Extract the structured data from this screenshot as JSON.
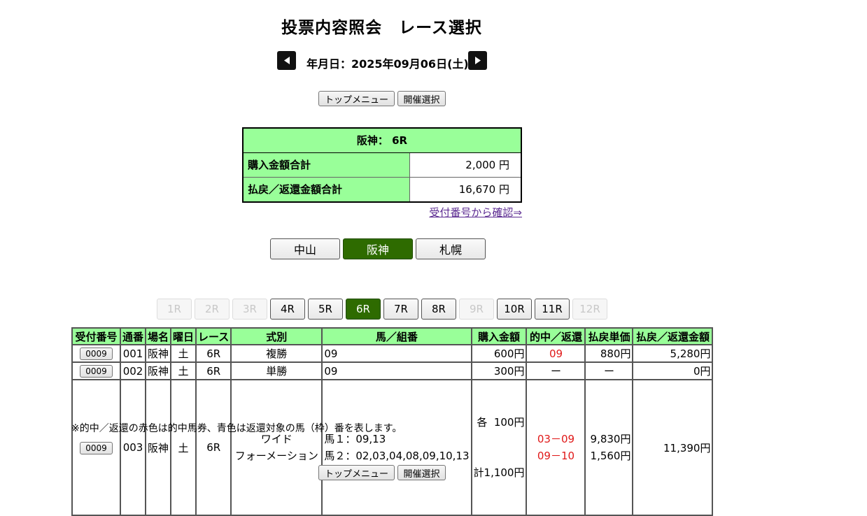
{
  "page_title": "投票内容照会　レース選択",
  "date_label": "年月日：2025年09月06日(土)",
  "buttons": {
    "top_menu": "トップメニュー",
    "meeting_select": "開催選択"
  },
  "summary": {
    "header": "阪神： 6R",
    "rows": [
      {
        "label": "購入金額合計",
        "value": "2,000 円"
      },
      {
        "label": "払戻／返還金額合計",
        "value": "16,670 円"
      }
    ]
  },
  "confirm_link": "受付番号から確認⇒",
  "venues": [
    {
      "label": "中山",
      "selected": false
    },
    {
      "label": "阪神",
      "selected": true
    },
    {
      "label": "札幌",
      "selected": false
    }
  ],
  "races": [
    {
      "label": "1R",
      "state": "disabled"
    },
    {
      "label": "2R",
      "state": "disabled"
    },
    {
      "label": "3R",
      "state": "disabled"
    },
    {
      "label": "4R",
      "state": "enabled"
    },
    {
      "label": "5R",
      "state": "enabled"
    },
    {
      "label": "6R",
      "state": "selected"
    },
    {
      "label": "7R",
      "state": "enabled"
    },
    {
      "label": "8R",
      "state": "enabled"
    },
    {
      "label": "9R",
      "state": "disabled"
    },
    {
      "label": "10R",
      "state": "enabled"
    },
    {
      "label": "11R",
      "state": "enabled"
    },
    {
      "label": "12R",
      "state": "disabled"
    }
  ],
  "table": {
    "headers": [
      "受付番号",
      "通番",
      "場名",
      "曜日",
      "レース",
      "式別",
      "馬／組番",
      "購入金額",
      "的中／返還",
      "払戻単価",
      "払戻／返還金額"
    ],
    "rows": [
      {
        "receipt": "0009",
        "serial": "001",
        "venue": "阪神",
        "day": "土",
        "race": "6R",
        "type": "複勝",
        "type2": "",
        "horses": "09",
        "horses2": "",
        "amount": "600円",
        "amount2": "",
        "hit": "09",
        "hit2": "",
        "unit": "880円",
        "unit2": "",
        "payout": "5,280円"
      },
      {
        "receipt": "0009",
        "serial": "002",
        "venue": "阪神",
        "day": "土",
        "race": "6R",
        "type": "単勝",
        "type2": "",
        "horses": "09",
        "horses2": "",
        "amount": "300円",
        "amount2": "",
        "hit": "ー",
        "hit2": "",
        "unit": "ー",
        "unit2": "",
        "payout": "0円"
      },
      {
        "receipt": "0009",
        "serial": "003",
        "venue": "阪神",
        "day": "土",
        "race": "6R",
        "type": "ワイド",
        "type2": "フォーメーション",
        "horses": "馬１：09,13",
        "horses2": "馬２：02,03,04,08,09,10,13",
        "amount": "各  100円",
        "amount2": "計1,100円",
        "hit": "03－09",
        "hit2": "09－10",
        "unit": "9,830円",
        "unit2": "1,560円",
        "payout": "11,390円"
      }
    ]
  },
  "note": "※的中／返還の赤色は的中馬券、青色は返還対象の馬（枠）番を表します。",
  "colors": {
    "header_green": "#99ff99",
    "selected_green": "#2e6b00",
    "hit_red": "#e01818",
    "link_purple": "#5b2a91"
  }
}
